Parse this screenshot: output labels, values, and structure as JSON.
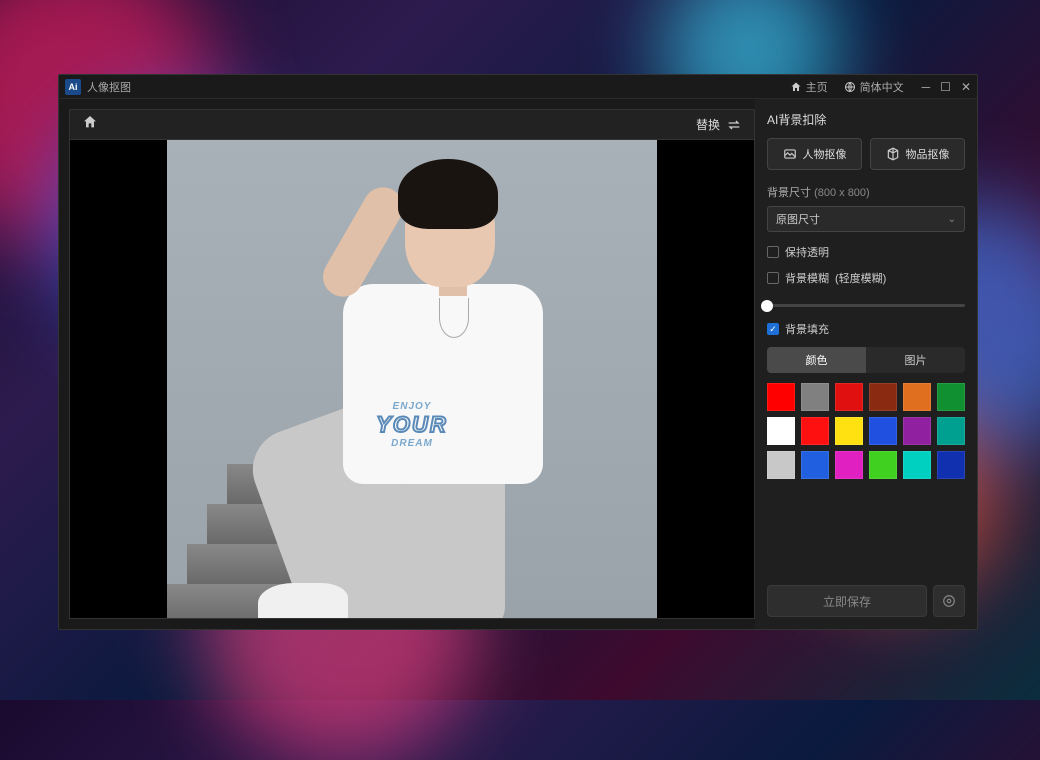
{
  "app": {
    "icon_text": "Ai",
    "title": "人像抠图"
  },
  "titlebar": {
    "home_label": "主页",
    "language_label": "简体中文"
  },
  "canvas": {
    "replace_label": "替换",
    "tshirt_main": "YOUR",
    "tshirt_top": "ENJOY",
    "tshirt_bottom": "DREAM"
  },
  "panel": {
    "title": "AI背景扣除",
    "person_matting": "人物抠像",
    "object_matting": "物品抠像",
    "bg_size_label": "背景尺寸",
    "bg_size_value": "(800 x 800)",
    "size_select_value": "原图尺寸",
    "keep_transparent": "保持透明",
    "bg_blur": "背景模糊",
    "bg_blur_hint": "(轻度模糊)",
    "bg_fill": "背景填充",
    "tab_color": "颜色",
    "tab_image": "图片",
    "save_label": "立即保存",
    "swatches": [
      "#ff0000",
      "#808080",
      "#e01010",
      "#8a2a10",
      "#e07020",
      "#109030",
      "#ffffff",
      "#ff1010",
      "#ffe010",
      "#2050e0",
      "#9020a0",
      "#00a090",
      "#c8c8c8",
      "#2060e0",
      "#e020c0",
      "#40d020",
      "#00d0c0",
      "#1030b0"
    ]
  }
}
